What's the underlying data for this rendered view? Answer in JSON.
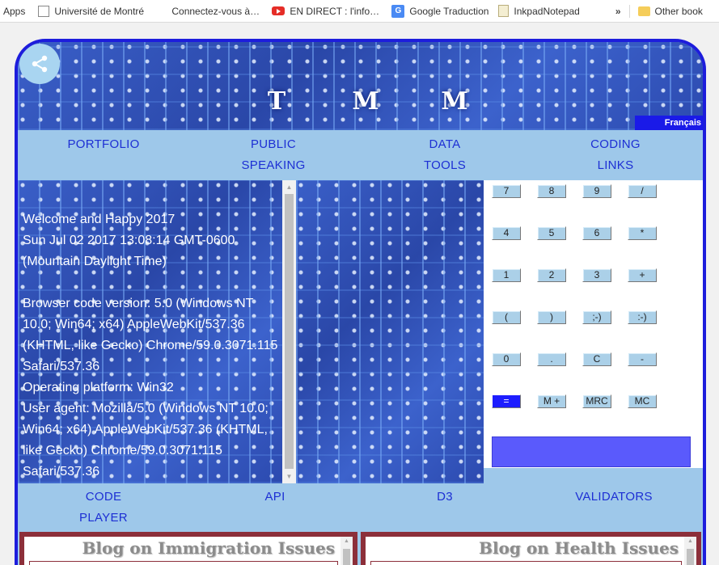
{
  "bookmarks": {
    "apps_label": "Apps",
    "items": [
      {
        "label": "Université de Montré",
        "icon": "udem-icon"
      },
      {
        "label": "Connectez-vous à vo",
        "icon": "microsoft-icon"
      },
      {
        "label": "EN DIRECT : l'info inte",
        "icon": "youtube-icon"
      },
      {
        "label": "Google Traduction",
        "icon": "google-translate-icon"
      },
      {
        "label": "InkpadNotepad",
        "icon": "inkpad-icon"
      }
    ],
    "more": "»",
    "other": "Other book"
  },
  "header": {
    "logo_letters": [
      "T",
      "M",
      "M"
    ],
    "language_button": "Français",
    "share_icon": "share-icon"
  },
  "nav_top": [
    {
      "line1": "PORTFOLIO",
      "line2": ""
    },
    {
      "line1": "PUBLIC",
      "line2": "SPEAKING"
    },
    {
      "line1": "DATA",
      "line2": "TOOLS"
    },
    {
      "line1": "CODING",
      "line2": "LINKS"
    }
  ],
  "info": {
    "greeting": "Welcome and Happy 2017",
    "date_line1": "Sun Jul 02 2017 13:08:14 GMT-0600",
    "date_line2": "(Mountain Daylight Time)",
    "browser_version": "Browser code version: 5.0 (Windows NT 10.0; Win64; x64) AppleWebKit/537.36 (KHTML, like Gecko) Chrome/59.0.3071.115 Safari/537.36",
    "platform": "Operating platform: Win32",
    "user_agent": "User agent: Mozilla/5.0 (Windows NT 10.0; Win64; x64) AppleWebKit/537.36 (KHTML, like Gecko) Chrome/59.0.3071.115 Safari/537.36"
  },
  "calculator": {
    "rows": [
      [
        "7",
        "8",
        "9",
        "/"
      ],
      [
        "4",
        "5",
        "6",
        "*"
      ],
      [
        "1",
        "2",
        "3",
        "+"
      ],
      [
        "(",
        ")",
        ";-)",
        ":-)"
      ],
      [
        "0",
        ".",
        "C",
        "-"
      ],
      [
        "=",
        "M +",
        "MRC",
        "MC"
      ]
    ],
    "display_value": ""
  },
  "nav_bottom": [
    {
      "line1": "CODE",
      "line2": "PLAYER"
    },
    {
      "line1": "API",
      "line2": ""
    },
    {
      "line1": "D3",
      "line2": ""
    },
    {
      "line1": "VALIDATORS",
      "line2": ""
    }
  ],
  "blogs": [
    {
      "title": "Blog on Immigration Issues"
    },
    {
      "title": "Blog on Health Issues"
    }
  ],
  "colors": {
    "frame_border": "#1d1ddc",
    "nav_background": "#9ec8ea",
    "nav_link": "#1d2fd4",
    "calc_key": "#abd0e8",
    "calc_equals": "#1d1dff",
    "calc_display": "#5a5afc",
    "blog_border": "#8c2f3a"
  }
}
